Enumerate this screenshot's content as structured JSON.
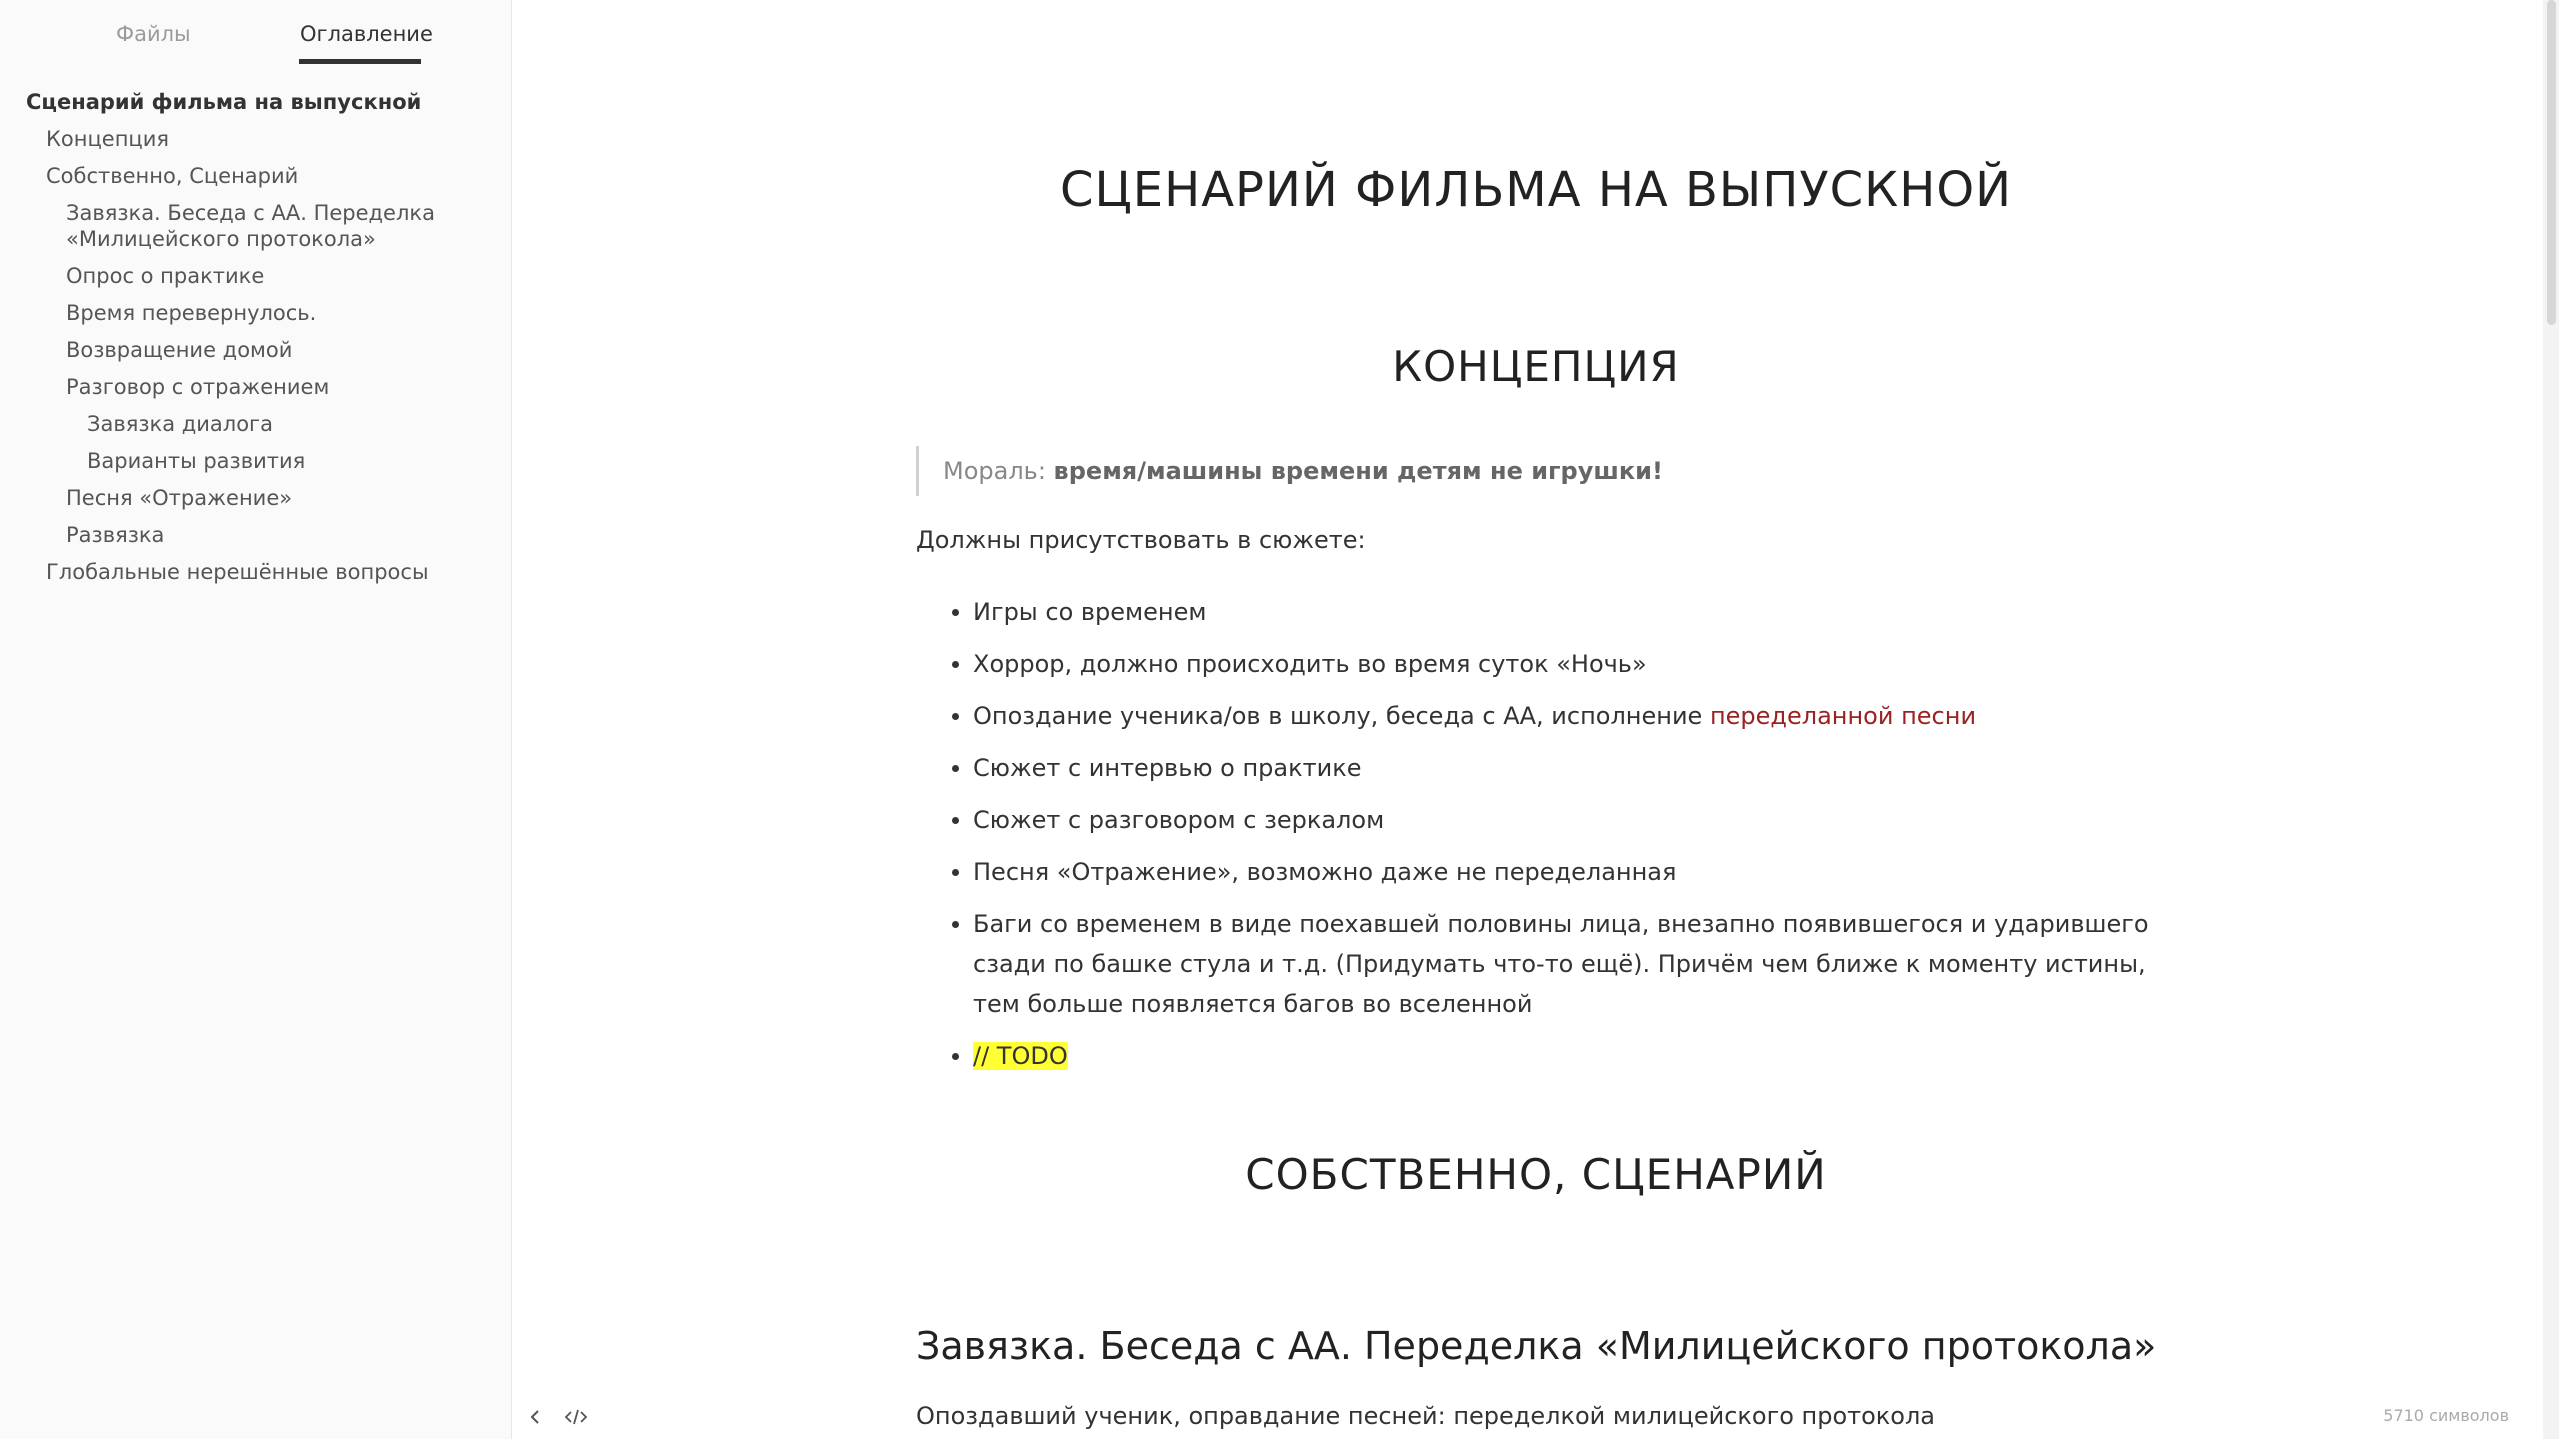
{
  "sidebar": {
    "tabs": {
      "files": "Файлы",
      "outline": "Оглавление"
    },
    "toc": [
      {
        "label": "Сценарий фильма на выпускной",
        "level": 1
      },
      {
        "label": "Концепция",
        "level": 2
      },
      {
        "label": "Собственно, Сценарий",
        "level": 2
      },
      {
        "label": "Завязка. Беседа с АА. Переделка «Милицейского протокола»",
        "level": 3
      },
      {
        "label": "Опрос о практике",
        "level": 3
      },
      {
        "label": "Время перевернулось.",
        "level": 3
      },
      {
        "label": "Возвращение домой",
        "level": 3
      },
      {
        "label": "Разговор с отражением",
        "level": 3
      },
      {
        "label": "Завязка диалога",
        "level": 4
      },
      {
        "label": "Варианты развития",
        "level": 4
      },
      {
        "label": "Песня «Отражение»",
        "level": 3
      },
      {
        "label": "Развязка",
        "level": 3
      },
      {
        "label": "Глобальные нерешённые вопросы",
        "level": 2
      }
    ]
  },
  "document": {
    "title": "СЦЕНАРИЙ ФИЛЬМА НА ВЫПУСКНОЙ",
    "concept_heading": "КОНЦЕПЦИЯ",
    "quote": {
      "label": "Мораль:",
      "text": "время/машины времени детям не игрушки!"
    },
    "must_present": "Должны присутствовать в сюжете:",
    "items": [
      {
        "text": "Игры со временем"
      },
      {
        "text": "Хоррор, должно происходить во время суток «Ночь»"
      },
      {
        "text": "Опоздание ученика/ов в школу, беседа с АА, исполнение ",
        "link": "переделанной песни"
      },
      {
        "text": "Сюжет с интервью о практике"
      },
      {
        "text": "Сюжет с разговором с зеркалом"
      },
      {
        "text": "Песня «Отражение», возможно даже не переделанная"
      },
      {
        "text": "Баги со временем в виде поехавшей половины лица, внезапно появившегося и ударившего сзади по башке стула и т.д. (Придумать что-то ещё). Причём чем ближе к моменту истины, тем больше появляется багов во вселенной"
      },
      {
        "highlight": "// TODO"
      }
    ],
    "script_heading": "СОБСТВЕННО, СЦЕНАРИЙ",
    "section_heading": "Завязка. Беседа с АА. Переделка «Милицейского протокола»",
    "section_para": "Опоздавший ученик, оправдание песней: переделкой милицейского протокола"
  },
  "statusbar": {
    "char_count": "5710 символов"
  },
  "icons": {
    "back": "chevron-left-icon",
    "source": "code-icon"
  },
  "colors": {
    "link": "#9b2222",
    "highlight": "#ffff33"
  }
}
